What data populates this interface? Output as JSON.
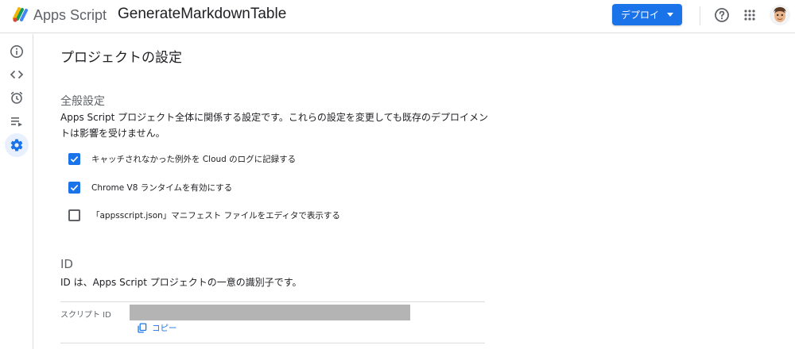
{
  "header": {
    "brand": "Apps Script",
    "project_title": "GenerateMarkdownTable",
    "deploy_label": "デプロイ",
    "icons": {
      "logo": "apps-script-logo-icon",
      "help": "help-circle-icon",
      "apps": "apps-grid-icon",
      "avatar": "user-avatar"
    }
  },
  "sidebar": {
    "items": [
      {
        "name": "overview",
        "icon": "info-icon",
        "active": false
      },
      {
        "name": "editor",
        "icon": "code-icon",
        "active": false
      },
      {
        "name": "triggers",
        "icon": "alarm-icon",
        "active": false
      },
      {
        "name": "executions",
        "icon": "executions-icon",
        "active": false
      },
      {
        "name": "settings",
        "icon": "gear-icon",
        "active": true
      }
    ]
  },
  "main": {
    "page_title": "プロジェクトの設定",
    "general": {
      "title": "全般設定",
      "description_line1": "Apps Script プロジェクト全体に関係する設定です。これらの設定を変更しても既存のデプロイメン",
      "description_line2": "トは影響を受けません。",
      "options": [
        {
          "label": "キャッチされなかった例外を Cloud のログに記録する",
          "checked": true
        },
        {
          "label": "Chrome V8 ランタイムを有効にする",
          "checked": true
        },
        {
          "label": "「appsscript.json」マニフェスト ファイルをエディタで表示する",
          "checked": false
        }
      ]
    },
    "ids": {
      "title": "ID",
      "description": "ID は、Apps Script プロジェクトの一意の識別子です。",
      "script_id_label": "スクリプト ID",
      "copy_label": "コピー"
    }
  },
  "colors": {
    "accent": "#1a73e8",
    "text": "#202124",
    "muted": "#5f6368",
    "divider": "#dadce0",
    "redacted": "#b4b4b4"
  }
}
